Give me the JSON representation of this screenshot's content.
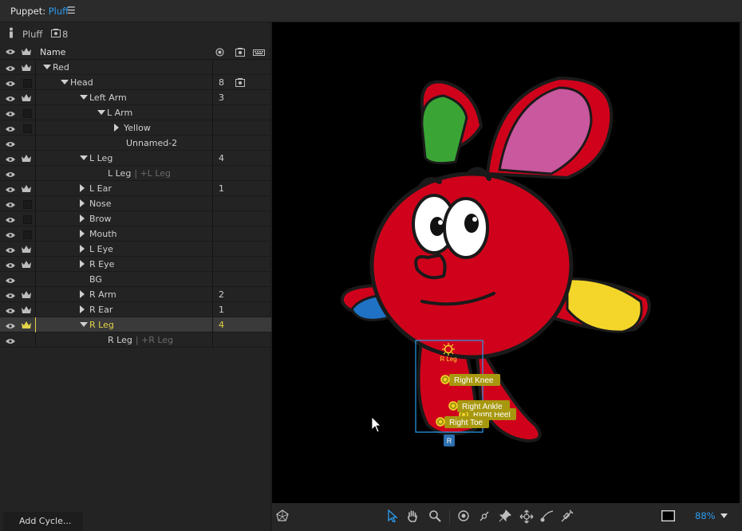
{
  "panel": {
    "label": "Puppet:",
    "name": "Pluff"
  },
  "puppet_info": {
    "name": "Pluff",
    "count": "8"
  },
  "columns": {
    "name": "Name"
  },
  "layers": [
    {
      "label": "Red",
      "crown": true,
      "tri": "down",
      "depth": 0,
      "value": ""
    },
    {
      "label": "Head",
      "crown": false,
      "tri": "down",
      "depth": 1,
      "value": "8",
      "cam": true
    },
    {
      "label": "Left Arm",
      "crown": true,
      "tri": "down",
      "depth": 2,
      "value": "3"
    },
    {
      "label": "L Arm",
      "crown": false,
      "tri": "down",
      "depth": 3,
      "value": ""
    },
    {
      "label": "Yellow",
      "crown": false,
      "tri": "right",
      "depth": 4,
      "value": ""
    },
    {
      "label": "Unnamed-2",
      "crown": false,
      "tri": "",
      "depth": 4,
      "value": "",
      "nochk": true
    },
    {
      "label": "L Leg",
      "crown": true,
      "tri": "down",
      "depth": 2,
      "value": "4"
    },
    {
      "label": "L Leg",
      "suffix": "| +L Leg",
      "crown": false,
      "tri": "",
      "depth": 3,
      "value": "",
      "nochk": true
    },
    {
      "label": "L Ear",
      "crown": true,
      "tri": "right",
      "depth": 2,
      "value": "1"
    },
    {
      "label": "Nose",
      "crown": false,
      "tri": "right",
      "depth": 2,
      "value": ""
    },
    {
      "label": "Brow",
      "crown": false,
      "tri": "right",
      "depth": 2,
      "value": ""
    },
    {
      "label": "Mouth",
      "crown": false,
      "tri": "right",
      "depth": 2,
      "value": ""
    },
    {
      "label": "L Eye",
      "crown": true,
      "tri": "right",
      "depth": 2,
      "value": ""
    },
    {
      "label": "R Eye",
      "crown": true,
      "tri": "right",
      "depth": 2,
      "value": ""
    },
    {
      "label": "BG",
      "crown": false,
      "tri": "",
      "depth": 2,
      "value": "",
      "nochk": true
    },
    {
      "label": "R Arm",
      "crown": true,
      "tri": "right",
      "depth": 2,
      "value": "2"
    },
    {
      "label": "R Ear",
      "crown": true,
      "tri": "right",
      "depth": 2,
      "value": "1"
    },
    {
      "label": "R Leg",
      "crown": true,
      "tri": "down",
      "depth": 2,
      "value": "4",
      "selected": true
    },
    {
      "label": "R Leg",
      "suffix": "| +R Leg",
      "crown": false,
      "tri": "",
      "depth": 3,
      "value": "",
      "nochk": true
    }
  ],
  "add_cycle": "Add Cycle...",
  "handles": {
    "origin": "R Leg",
    "knee": "Right Knee",
    "ankle": "Right Ankle",
    "heel": "Right Heel",
    "toe": "Right Toe",
    "badge": "R"
  },
  "zoom": "88%",
  "colors": {
    "accent": "#2d9cf0",
    "selected": "#e4d24a",
    "body": "#d0021b",
    "tag": "#a8980f"
  }
}
